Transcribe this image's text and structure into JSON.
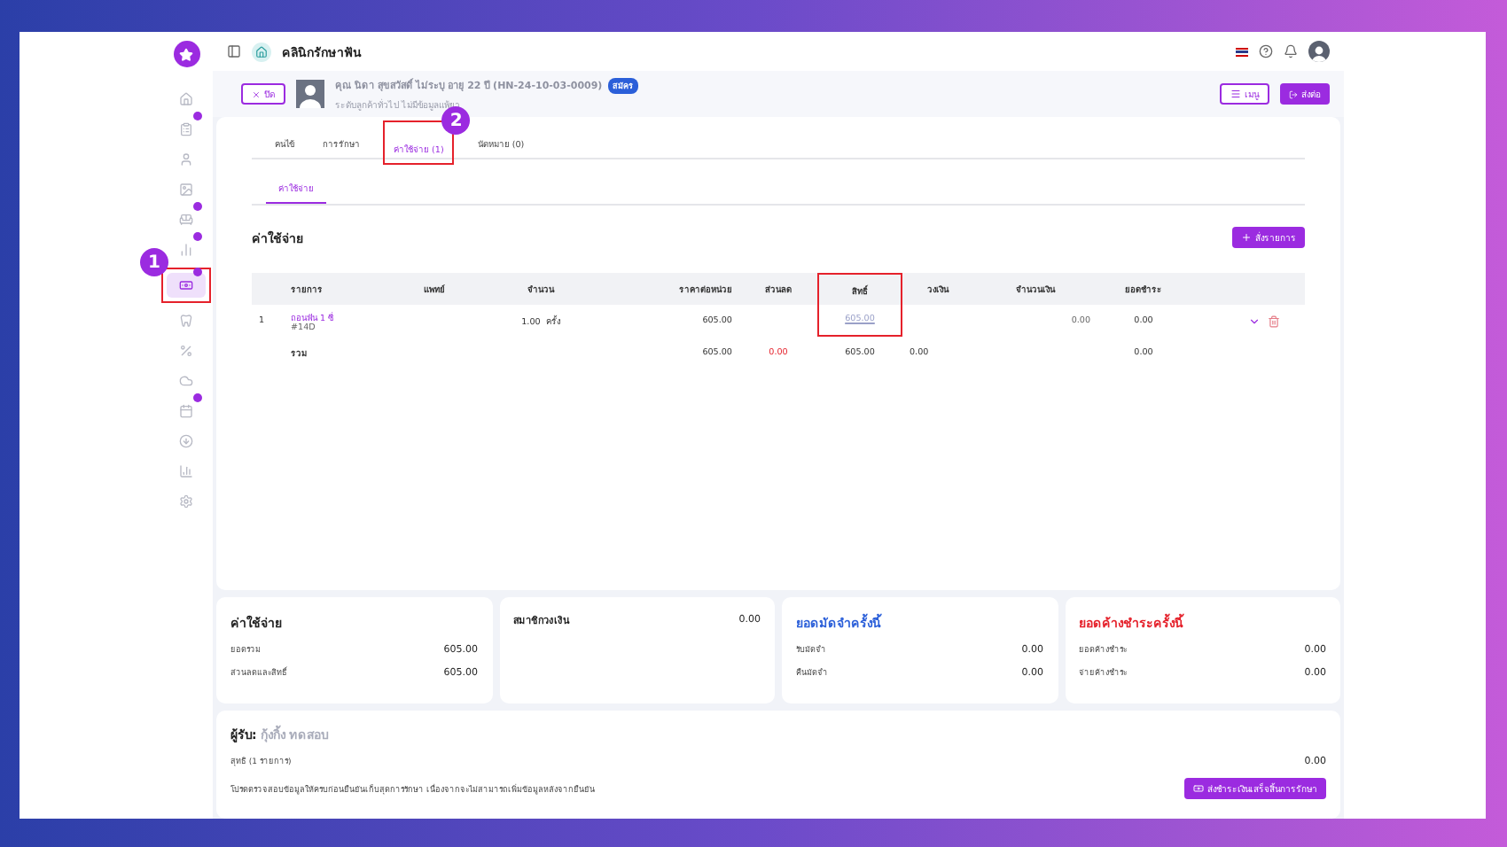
{
  "topbar": {
    "clinic_name": "คลินิกรักษาฟัน"
  },
  "sidebar": {
    "items": [
      {
        "kind": "home",
        "badge": false,
        "selected": false
      },
      {
        "kind": "clipboard",
        "badge": true,
        "selected": false
      },
      {
        "kind": "user",
        "badge": false,
        "selected": false
      },
      {
        "kind": "image",
        "badge": false,
        "selected": false
      },
      {
        "kind": "sofa",
        "badge": true,
        "selected": false
      },
      {
        "kind": "bars",
        "badge": true,
        "selected": false
      },
      {
        "kind": "cash",
        "badge": true,
        "selected": true,
        "highlight": "1"
      },
      {
        "kind": "tooth",
        "badge": false,
        "selected": false
      },
      {
        "kind": "percent",
        "badge": false,
        "selected": false
      },
      {
        "kind": "cloud",
        "badge": false,
        "selected": false
      },
      {
        "kind": "calendar",
        "badge": true,
        "selected": false
      },
      {
        "kind": "download",
        "badge": false,
        "selected": false
      },
      {
        "kind": "chart",
        "badge": false,
        "selected": false
      },
      {
        "kind": "settings",
        "badge": false,
        "selected": false
      }
    ]
  },
  "patient": {
    "close": "ปิด",
    "name": "คุณ นิดา สุขสวัสดิ์ ไม่ระบุ อายุ 22 ปี (HN-24-10-03-0009)",
    "detail": "ระดับลูกค้าทั่วไป ไม่มีข้อมูลแพ้ยา",
    "badge": "สมัคร",
    "menu": "เมนู",
    "forward": "ส่งต่อ"
  },
  "tabs": [
    {
      "label": "คนไข้",
      "selected": false
    },
    {
      "label": "การรักษา",
      "selected": false
    },
    {
      "label": "ค่าใช้จ่าย (1)",
      "selected": true,
      "highlight": "2"
    },
    {
      "label": "นัดหมาย (0)",
      "selected": false
    }
  ],
  "subtabs": [
    {
      "label": "ค่าใช้จ่าย",
      "selected": true
    }
  ],
  "section": {
    "title": "ค่าใช้จ่าย",
    "add_button": "สั่งรายการ"
  },
  "table": {
    "columns": [
      {
        "highlighted": false
      },
      {
        "label": "รายการ",
        "highlighted": false
      },
      {
        "label": "แพทย์",
        "highlighted": false
      },
      {
        "label": "จำนวน",
        "highlighted": false
      },
      {
        "label": "ราคาต่อหน่วย",
        "highlighted": false
      },
      {
        "label": "ส่วนลด",
        "highlighted": false
      },
      {
        "label": "สิทธิ์",
        "highlighted": true
      },
      {
        "label": "วงเงิน",
        "highlighted": false
      },
      {
        "label": "จำนวนเงิน",
        "highlighted": false
      },
      {
        "label": "ยอดชำระ",
        "highlighted": false
      }
    ],
    "rows": [
      {
        "no": "1",
        "item": "ถอนฟัน 1 ซี่",
        "code": "#14D",
        "qty": "1.00",
        "unit": "ครั้ง",
        "price": "605.00",
        "rights": "605.00",
        "amount": "0.00",
        "pay": "0.00"
      }
    ],
    "total": {
      "label": "รวม",
      "price": "605.00",
      "discount": "0.00",
      "rights": "605.00",
      "limit": "0.00",
      "pay": "0.00"
    }
  },
  "summary": [
    {
      "title": "ค่าใช้จ่าย",
      "color": "#222222",
      "lines": [
        {
          "label": "ยอดรวม",
          "value": "605.00"
        },
        {
          "label": "ส่วนลดและสิทธิ์",
          "value": "605.00"
        }
      ]
    },
    {
      "title": "สมาชิกวงเงิน",
      "color": "#222222",
      "value": "0.00"
    },
    {
      "title": "ยอดมัดจำครั้งนี้",
      "color": "#2b5fd9",
      "lines": [
        {
          "label": "รับมัดจำ",
          "value": "0.00"
        },
        {
          "label": "คืนมัดจำ",
          "value": "0.00"
        }
      ]
    },
    {
      "title": "ยอดค้างชำระครั้งนี้",
      "color": "#e5212b",
      "lines": [
        {
          "label": "ยอดค้างชำระ",
          "value": "0.00"
        },
        {
          "label": "จ่ายค้างชำระ",
          "value": "0.00"
        }
      ]
    }
  ],
  "footer": {
    "receiver_label": "ผู้รับ:",
    "receiver": "กุ้งกิ้ง ทดสอบ",
    "net_label": "สุทธิ (1 รายการ)",
    "net": "0.00",
    "note": "โปรดตรวจสอบข้อมูลให้ครบก่อนยืนยันเก็บสุดการรักษา เนื่องจากจะไม่สามารถเพิ่มข้อมูลหลังจากยืนยัน",
    "submit": "ส่งชำระเงินเสร็จสิ้นการรักษา"
  }
}
